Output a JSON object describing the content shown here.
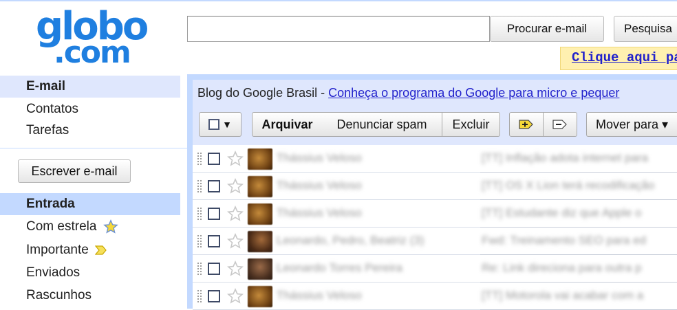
{
  "logo": {
    "line1": "globo",
    "line2": ".com"
  },
  "search": {
    "value": "",
    "search_label": "Procurar e-mail",
    "web_label": "Pesquisa"
  },
  "promo": {
    "text": "Clique aqui par"
  },
  "sidebar": {
    "top_items": [
      {
        "label": "E-mail"
      },
      {
        "label": "Contatos"
      },
      {
        "label": "Tarefas"
      }
    ],
    "compose_label": "Escrever e-mail",
    "folders": [
      {
        "label": "Entrada"
      },
      {
        "label": "Com estrela"
      },
      {
        "label": "Importante"
      },
      {
        "label": "Enviados"
      },
      {
        "label": "Rascunhos"
      }
    ]
  },
  "banner": {
    "prefix": "Blog do Google Brasil - ",
    "link": "Conheça o programa do Google para micro e pequer"
  },
  "toolbar": {
    "archive": "Arquivar",
    "report_spam": "Denunciar spam",
    "delete": "Excluir",
    "move_to": "Mover para ▾"
  },
  "messages": [
    {
      "sender": "Thássius Veloso",
      "subject": "[TT] Inflação adota internet para"
    },
    {
      "sender": "Thássius Veloso",
      "subject": "[TT] OS X Lion terá recodificação"
    },
    {
      "sender": "Thássius Veloso",
      "subject": "[TT] Estudante diz que Apple o"
    },
    {
      "sender": "Leonardo, Pedro, Beatriz (3)",
      "subject": "Fwd: Treinamento SEO para ed"
    },
    {
      "sender": "Leonardo Torres Pereira",
      "subject": "Re: Link direciona para outra p"
    },
    {
      "sender": "Thássius Veloso",
      "subject": "[TT] Motorola vai acabar com a"
    }
  ],
  "colors": {
    "accent": "#c3d9ff",
    "accent_light": "#dfe7fd",
    "link": "#2222cc",
    "logo": "#1f7fe0",
    "promo_bg": "#fff0b0"
  }
}
